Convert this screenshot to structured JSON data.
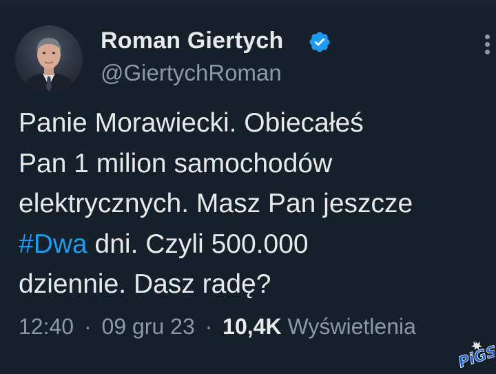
{
  "author": {
    "name": "Roman Giertych",
    "handle": "@GiertychRoman",
    "verified": true
  },
  "tweet": {
    "lines": [
      {
        "text": "Panie Morawiecki. Obiecałeś"
      },
      {
        "text": "Pan 1 milion samochodów"
      },
      {
        "text": "elektrycznych. Masz Pan jeszcze"
      },
      {
        "hashtag": "#Dwa",
        "text": " dni. Czyli 500.000"
      },
      {
        "text": "dziennie. Dasz radę?"
      }
    ]
  },
  "meta": {
    "time": "12:40",
    "separator": "·",
    "date": "09 gru 23",
    "views_count": "10,4K",
    "views_label": "Wyświetlenia"
  },
  "watermark": {
    "text": "PiGS"
  },
  "colors": {
    "background": "#15202b",
    "text": "#e7e9ea",
    "secondary": "#8b98a5",
    "link": "#1d9bf0",
    "verified": "#1d9bf0"
  },
  "icons": {
    "verified": "verified-badge-icon",
    "more": "more-vertical-icon"
  }
}
